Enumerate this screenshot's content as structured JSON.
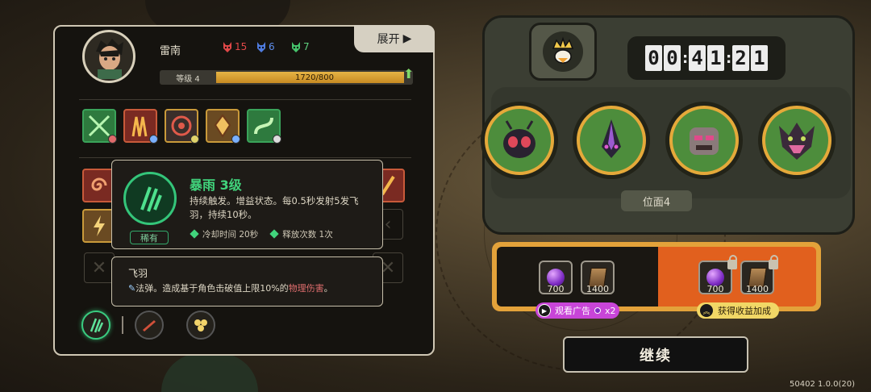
{
  "character": {
    "name": "雷南",
    "stats": [
      {
        "icon": "red-mask-icon",
        "value": "15",
        "color": "#e04848"
      },
      {
        "icon": "blue-mask-icon",
        "value": "6",
        "color": "#4f7ce0"
      },
      {
        "icon": "green-mask-icon",
        "value": "7",
        "color": "#46c46c"
      }
    ],
    "level_label": "等级 4",
    "xp": "1720/800",
    "xp_fraction": 0.98,
    "expand_label": "展开"
  },
  "tooltip": {
    "skill_name": "暴雨 3级",
    "rarity": "稀有",
    "description": "持续触发。增益状态。每0.5秒发射5发飞羽，持续10秒。",
    "cooldown": "冷却时间 20秒",
    "casts": "释放次数 1次"
  },
  "subtooltip": {
    "title": "飞羽",
    "prefix": "法弹。造成基于角色击破值上限10%的",
    "damage": "物理伤害",
    "suffix": "。"
  },
  "timer": {
    "d1": "0",
    "d2": "0",
    "d3": "4",
    "d4": "1",
    "d5": "2",
    "d6": "1"
  },
  "plane_label": "位面4",
  "rewards": {
    "base": [
      {
        "icon": "purple-gem-icon",
        "value": "700"
      },
      {
        "icon": "card-icon",
        "value": "1400"
      }
    ],
    "boosted": [
      {
        "icon": "purple-gem-icon",
        "value": "700"
      },
      {
        "icon": "card-icon",
        "value": "1400"
      }
    ],
    "watch_ad": "观看广告",
    "watch_ad_mult": "x2",
    "boost_label": "获得收益加成"
  },
  "continue_label": "继续",
  "version": "50402 1.0.0(20)"
}
